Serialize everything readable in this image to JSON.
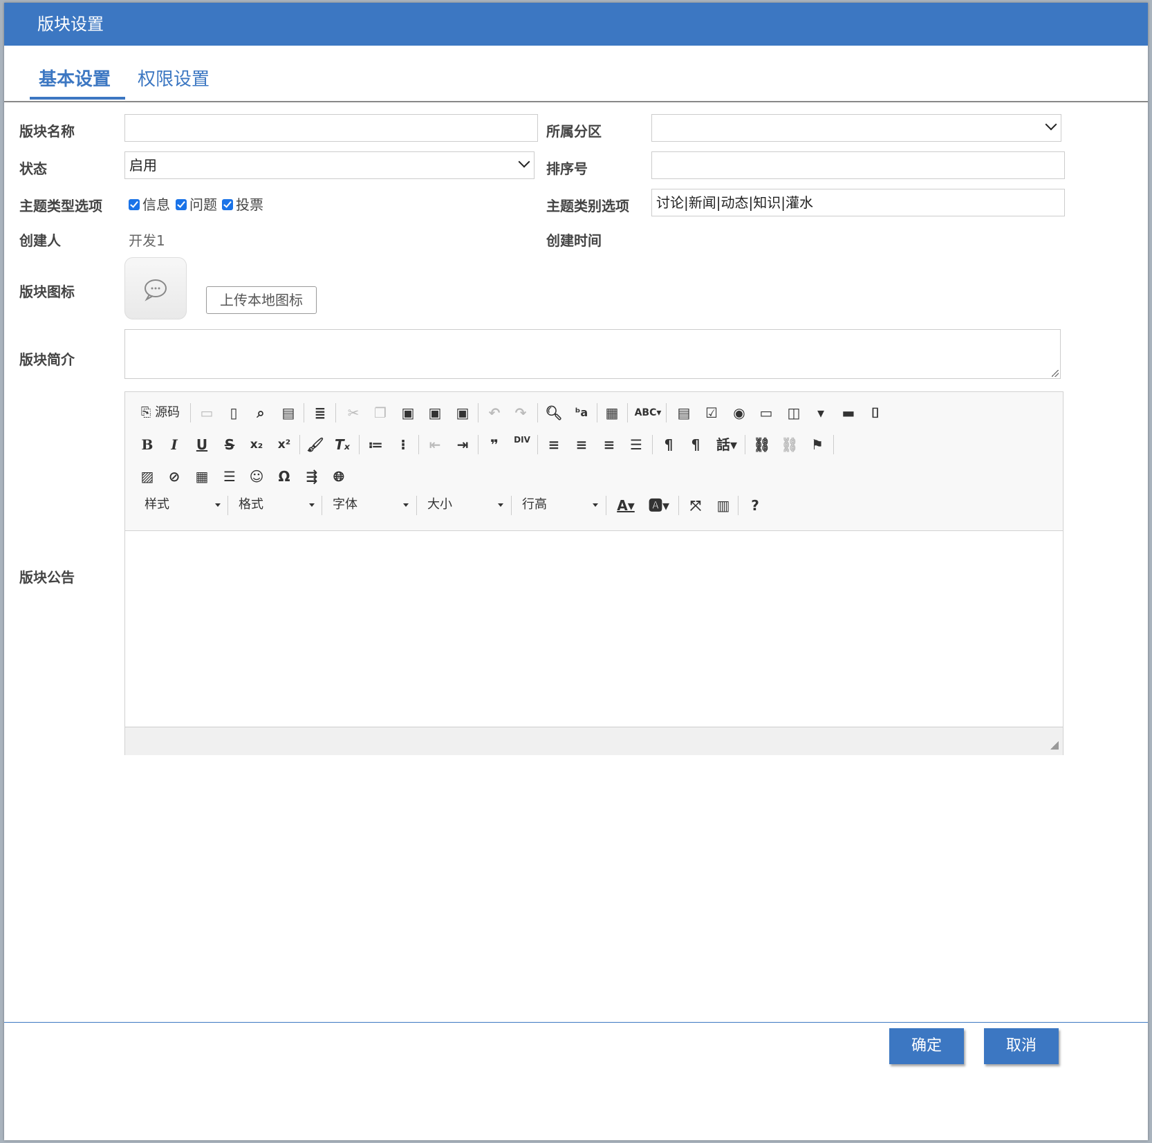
{
  "dialog": {
    "title": "版块设置"
  },
  "tabs": [
    {
      "label": "基本设置"
    },
    {
      "label": "权限设置"
    }
  ],
  "form": {
    "board_name": {
      "label": "版块名称",
      "value": ""
    },
    "zone": {
      "label": "所属分区",
      "value": ""
    },
    "status": {
      "label": "状态",
      "value": "启用"
    },
    "order": {
      "label": "排序号",
      "value": ""
    },
    "topic_types": {
      "label": "主题类型选项",
      "options": [
        "信息",
        "问题",
        "投票"
      ]
    },
    "topic_categories": {
      "label": "主题类别选项",
      "value": "讨论|新闻|动态|知识|灌水"
    },
    "creator": {
      "label": "创建人",
      "value": "开发1"
    },
    "created_time": {
      "label": "创建时间",
      "value": ""
    },
    "icon": {
      "label": "版块图标",
      "upload_label": "上传本地图标"
    },
    "intro": {
      "label": "版块简介",
      "value": ""
    },
    "notice": {
      "label": "版块公告"
    }
  },
  "editor": {
    "source_label": "源码",
    "combos": [
      "样式",
      "格式",
      "字体",
      "大小",
      "行高"
    ]
  },
  "buttons": {
    "ok": "确定",
    "cancel": "取消"
  },
  "colors": {
    "accent": "#3c77c2",
    "checkbox": "#1a73e8"
  }
}
